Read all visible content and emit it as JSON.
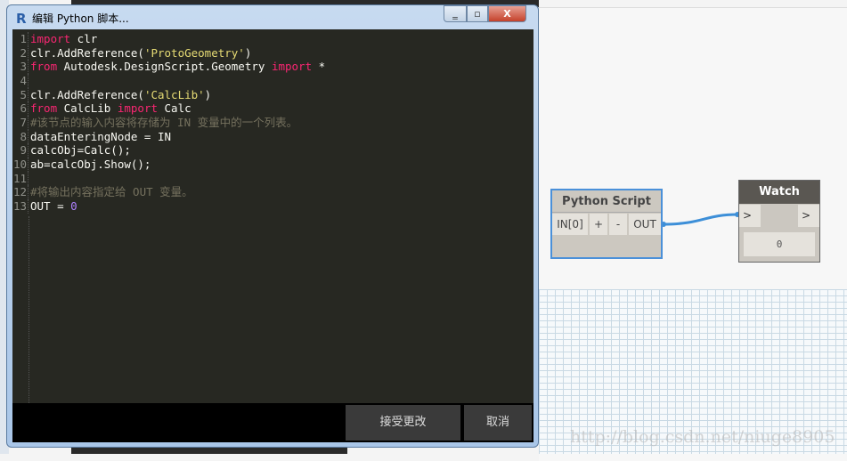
{
  "dialog": {
    "title": "编辑 Python 脚本...",
    "app_icon": "R",
    "minimize": "‗",
    "maximize": "▫",
    "close": "X",
    "accept_label": "接受更改",
    "cancel_label": "取消"
  },
  "code": [
    [
      {
        "t": "import",
        "c": "kw"
      },
      {
        "t": " clr"
      }
    ],
    [
      {
        "t": "clr.AddReference("
      },
      {
        "t": "'ProtoGeometry'",
        "c": "str"
      },
      {
        "t": ")"
      }
    ],
    [
      {
        "t": "from",
        "c": "kw"
      },
      {
        "t": " Autodesk.DesignScript.Geometry "
      },
      {
        "t": "import",
        "c": "kw"
      },
      {
        "t": " *"
      }
    ],
    [],
    [
      {
        "t": "clr.AddReference("
      },
      {
        "t": "'CalcLib'",
        "c": "str"
      },
      {
        "t": ")"
      }
    ],
    [
      {
        "t": "from",
        "c": "kw"
      },
      {
        "t": " CalcLib "
      },
      {
        "t": "import",
        "c": "kw"
      },
      {
        "t": " Calc"
      }
    ],
    [
      {
        "t": "#该节点的输入内容将存储为 IN 变量中的一个列表。",
        "c": "cm"
      }
    ],
    [
      {
        "t": "dataEnteringNode = IN"
      }
    ],
    [
      {
        "t": "calcObj=Calc();"
      }
    ],
    [
      {
        "t": "ab=calcObj.Show();"
      }
    ],
    [],
    [
      {
        "t": "#将输出内容指定给 OUT 变量。",
        "c": "cm"
      }
    ],
    [
      {
        "t": "OUT = "
      },
      {
        "t": "0",
        "c": "num"
      }
    ]
  ],
  "python_node": {
    "title": "Python Script",
    "input": "IN[0]",
    "add": "+",
    "remove": "-",
    "output": "OUT"
  },
  "watch_node": {
    "title": "Watch",
    "in_port": ">",
    "out_port": ">",
    "value": "0"
  },
  "watermark": "http://blog.csdn.net/niuge8905",
  "colors": {
    "wire": "#3d8fd8",
    "node_selected": "#4a90d9",
    "editor_bg": "#272822"
  }
}
